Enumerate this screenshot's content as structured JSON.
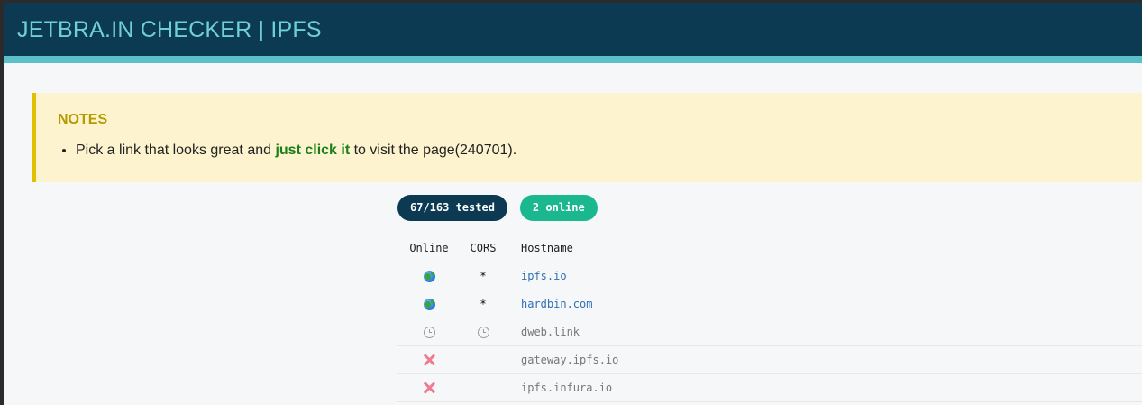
{
  "header": {
    "title": "JETBRA.IN CHECKER | IPFS"
  },
  "notes": {
    "title": "NOTES",
    "item_prefix": "Pick a link that looks great and ",
    "item_highlight": "just click it",
    "item_suffix": " to visit the page(240701)."
  },
  "status": {
    "tested_label": "67/163 tested",
    "online_label": "2 online"
  },
  "table": {
    "columns": [
      "Online",
      "CORS",
      "Hostname"
    ],
    "rows": [
      {
        "online_icon": "globe-icon",
        "cors": "*",
        "hostname": "ipfs.io",
        "state": "online"
      },
      {
        "online_icon": "globe-icon",
        "cors": "*",
        "hostname": "hardbin.com",
        "state": "online"
      },
      {
        "online_icon": "clock-icon",
        "cors_icon": "clock-icon",
        "cors": "",
        "hostname": "dweb.link",
        "state": "pending"
      },
      {
        "online_icon": "cross-icon",
        "cors": "",
        "hostname": "gateway.ipfs.io",
        "state": "offline"
      },
      {
        "online_icon": "cross-icon",
        "cors": "",
        "hostname": "ipfs.infura.io",
        "state": "offline"
      }
    ]
  },
  "colors": {
    "header_bg": "#0c3a52",
    "header_text": "#6fcfd8",
    "header_accent": "#5bc0c8",
    "notes_bg": "#fdf4cf",
    "notes_border": "#e2c000",
    "highlight": "#1a7f1a",
    "online_badge": "#1bb890",
    "link": "#2f6fb5",
    "offline_cross": "#ef7b90"
  }
}
